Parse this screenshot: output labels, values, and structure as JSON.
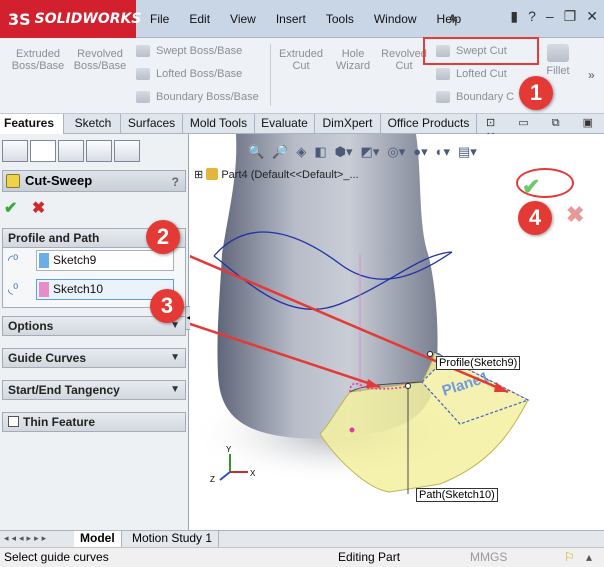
{
  "app": {
    "logo": "SOLIDWORKS",
    "logo_mark": "3S"
  },
  "menu": [
    "File",
    "Edit",
    "View",
    "Insert",
    "Tools",
    "Window",
    "Help"
  ],
  "ribbon": {
    "extruded_boss": "Extruded\nBoss/Base",
    "revolved_boss": "Revolved\nBoss/Base",
    "swept_boss": "Swept Boss/Base",
    "lofted_boss": "Lofted Boss/Base",
    "boundary_boss": "Boundary Boss/Base",
    "extruded_cut": "Extruded\nCut",
    "hole_wizard": "Hole\nWizard",
    "revolved_cut": "Revolved\nCut",
    "swept_cut": "Swept Cut",
    "lofted_cut": "Lofted Cut",
    "boundary_cut": "Boundary C",
    "fillet": "Fillet"
  },
  "tabs": [
    "Features",
    "Sketch",
    "Surfaces",
    "Mold Tools",
    "Evaluate",
    "DimXpert",
    "Office Products"
  ],
  "feature_manager": {
    "title": "Cut-Sweep",
    "help": "?",
    "sections": {
      "profile_path": "Profile and Path",
      "options": "Options",
      "guide_curves": "Guide Curves",
      "start_end": "Start/End Tangency",
      "thin": "Thin Feature"
    },
    "profile_value": "Sketch9",
    "path_value": "Sketch10"
  },
  "viewport": {
    "tree_item": "Part4  (Default<<Default>_...",
    "profile_label": "Profile(Sketch9)",
    "path_label": "Path(Sketch10)",
    "plane_text": "Plane1"
  },
  "callouts": [
    "1",
    "2",
    "3",
    "4"
  ],
  "bottom_tabs": [
    "Model",
    "Motion Study 1"
  ],
  "status": {
    "hint": "Select guide curves",
    "mode": "Editing Part",
    "units": "MMGS"
  },
  "colors": {
    "callout": "#e53935",
    "ok_green": "#3aa83a",
    "cancel_red": "#d64545",
    "solid_fill": "#a6acb8",
    "sweep_fill": "#f3f0a0"
  }
}
